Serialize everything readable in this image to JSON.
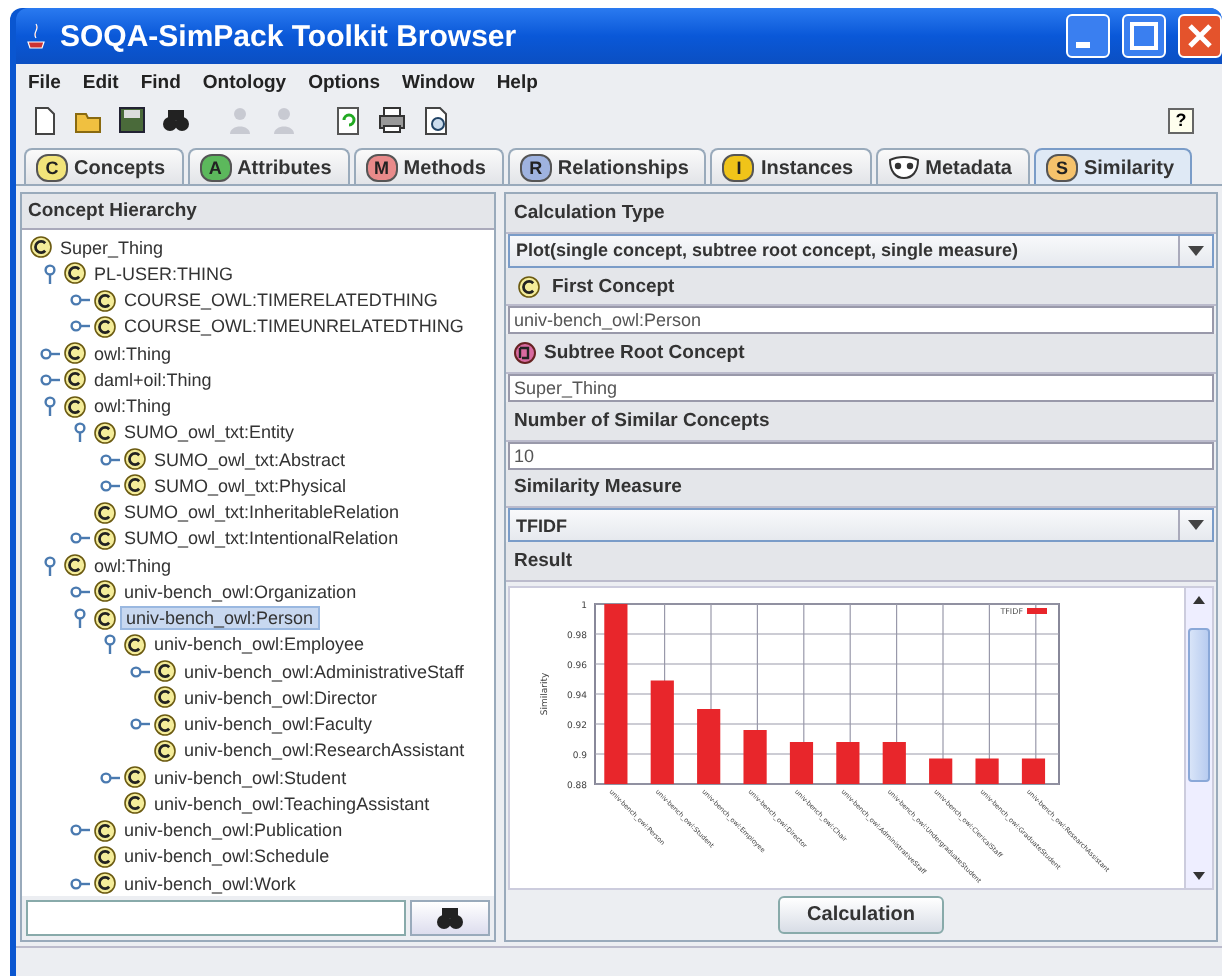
{
  "window": {
    "title": "SOQA-SimPack Toolkit Browser"
  },
  "menu": [
    "File",
    "Edit",
    "Find",
    "Ontology",
    "Options",
    "Window",
    "Help"
  ],
  "toolbar": [
    {
      "kind": "new",
      "disabled": false
    },
    {
      "kind": "open",
      "disabled": false
    },
    {
      "kind": "save",
      "disabled": false
    },
    {
      "kind": "find",
      "disabled": false
    },
    {
      "kind": "person",
      "disabled": true
    },
    {
      "kind": "person",
      "disabled": true
    },
    {
      "kind": "refresh",
      "disabled": false
    },
    {
      "kind": "print",
      "disabled": false
    },
    {
      "kind": "preview",
      "disabled": false
    }
  ],
  "help_button": "?",
  "tabs": [
    {
      "label": "Concepts",
      "icon": "C",
      "color": "#f2e47a",
      "selected": false
    },
    {
      "label": "Attributes",
      "icon": "A",
      "color": "#5cb85c",
      "selected": false
    },
    {
      "label": "Methods",
      "icon": "M",
      "color": "#e88a8a",
      "selected": false
    },
    {
      "label": "Relationships",
      "icon": "R",
      "color": "#9fb3e0",
      "selected": false
    },
    {
      "label": "Instances",
      "icon": "I",
      "color": "#f0c419",
      "selected": false
    },
    {
      "label": "Metadata",
      "color": "#ffffff",
      "selected": false
    },
    {
      "label": "Similarity",
      "icon": "S",
      "color": "#f5c26b",
      "selected": true
    }
  ],
  "left_panel": {
    "title": "Concept Hierarchy",
    "tree": [
      {
        "label": "Super_Thing",
        "selected": false,
        "children": [
          {
            "label": "PL-USER:THING",
            "expanded": true,
            "selected": false,
            "children": [
              {
                "label": "COURSE_OWL:TIMERELATEDTHING",
                "expanded": false,
                "selected": false
              },
              {
                "label": "COURSE_OWL:TIMEUNRELATEDTHING",
                "expanded": false,
                "selected": false
              }
            ]
          },
          {
            "label": "owl:Thing",
            "expanded": false,
            "selected": false
          },
          {
            "label": "daml+oil:Thing",
            "expanded": false,
            "selected": false
          },
          {
            "label": "owl:Thing",
            "expanded": true,
            "selected": false,
            "children": [
              {
                "label": "SUMO_owl_txt:Entity",
                "expanded": true,
                "selected": false,
                "children": [
                  {
                    "label": "SUMO_owl_txt:Abstract",
                    "expanded": false,
                    "selected": false
                  },
                  {
                    "label": "SUMO_owl_txt:Physical",
                    "expanded": false,
                    "selected": false
                  }
                ]
              },
              {
                "label": "SUMO_owl_txt:InheritableRelation",
                "selected": false
              },
              {
                "label": "SUMO_owl_txt:IntentionalRelation",
                "expanded": false,
                "selected": false
              }
            ]
          },
          {
            "label": "owl:Thing",
            "expanded": true,
            "selected": false,
            "children": [
              {
                "label": "univ-bench_owl:Organization",
                "expanded": false,
                "selected": false
              },
              {
                "label": "univ-bench_owl:Person",
                "expanded": true,
                "selected": true,
                "children": [
                  {
                    "label": "univ-bench_owl:Employee",
                    "expanded": true,
                    "selected": false,
                    "children": [
                      {
                        "label": "univ-bench_owl:AdministrativeStaff",
                        "expanded": false,
                        "selected": false
                      },
                      {
                        "label": "univ-bench_owl:Director",
                        "selected": false
                      },
                      {
                        "label": "univ-bench_owl:Faculty",
                        "expanded": false,
                        "selected": false
                      },
                      {
                        "label": "univ-bench_owl:ResearchAssistant",
                        "selected": false
                      }
                    ]
                  },
                  {
                    "label": "univ-bench_owl:Student",
                    "expanded": false,
                    "selected": false
                  },
                  {
                    "label": "univ-bench_owl:TeachingAssistant",
                    "selected": false
                  }
                ]
              },
              {
                "label": "univ-bench_owl:Publication",
                "expanded": false,
                "selected": false
              },
              {
                "label": "univ-bench_owl:Schedule",
                "selected": false
              },
              {
                "label": "univ-bench_owl:Work",
                "expanded": false,
                "selected": false
              }
            ]
          }
        ]
      }
    ]
  },
  "right_panel": {
    "calculation_type": {
      "label": "Calculation Type",
      "value": "Plot(single concept, subtree root concept, single measure)"
    },
    "first_concept": {
      "label": "First Concept",
      "value": "univ-bench_owl:Person"
    },
    "subtree_root_concept": {
      "label": "Subtree Root Concept",
      "value": "Super_Thing"
    },
    "number_of_similar_concepts": {
      "label": "Number of Similar Concepts",
      "value": "10"
    },
    "similarity_measure": {
      "label": "Similarity Measure",
      "value": "TFIDF"
    },
    "result": {
      "label": "Result",
      "chart_data": {
        "type": "bar",
        "grid": true,
        "ylabel": "Similarity",
        "categories": [
          "univ-bench_owl:Person",
          "univ-bench_owl:Student",
          "univ-bench_owl:Employee",
          "univ-bench_owl:Director",
          "univ-bench_owl:Chair",
          "univ-bench_owl:AdministrativeStaff",
          "univ-bench_owl:UndergraduateStudent",
          "univ-bench_owl:ClericalStaff",
          "univ-bench_owl:GraduateStudent",
          "univ-bench_owl:ResearchAssistant"
        ],
        "series": [
          {
            "name": "TFIDF",
            "color": "#e8262b",
            "values": [
              1.0,
              0.949,
              0.93,
              0.916,
              0.908,
              0.908,
              0.908,
              0.897,
              0.897,
              0.897
            ]
          }
        ],
        "ylim": [
          0.88,
          1.0
        ],
        "yticks": [
          {
            "value": 0.88,
            "label": "0.88"
          },
          {
            "value": 0.9,
            "label": "0.9"
          },
          {
            "value": 0.92,
            "label": "0.92"
          },
          {
            "value": 0.94,
            "label": "0.94"
          },
          {
            "value": 0.96,
            "label": "0.96"
          },
          {
            "value": 0.98,
            "label": "0.98"
          },
          {
            "value": 1,
            "label": "1"
          }
        ]
      }
    },
    "calculate_button": "Calculation"
  }
}
